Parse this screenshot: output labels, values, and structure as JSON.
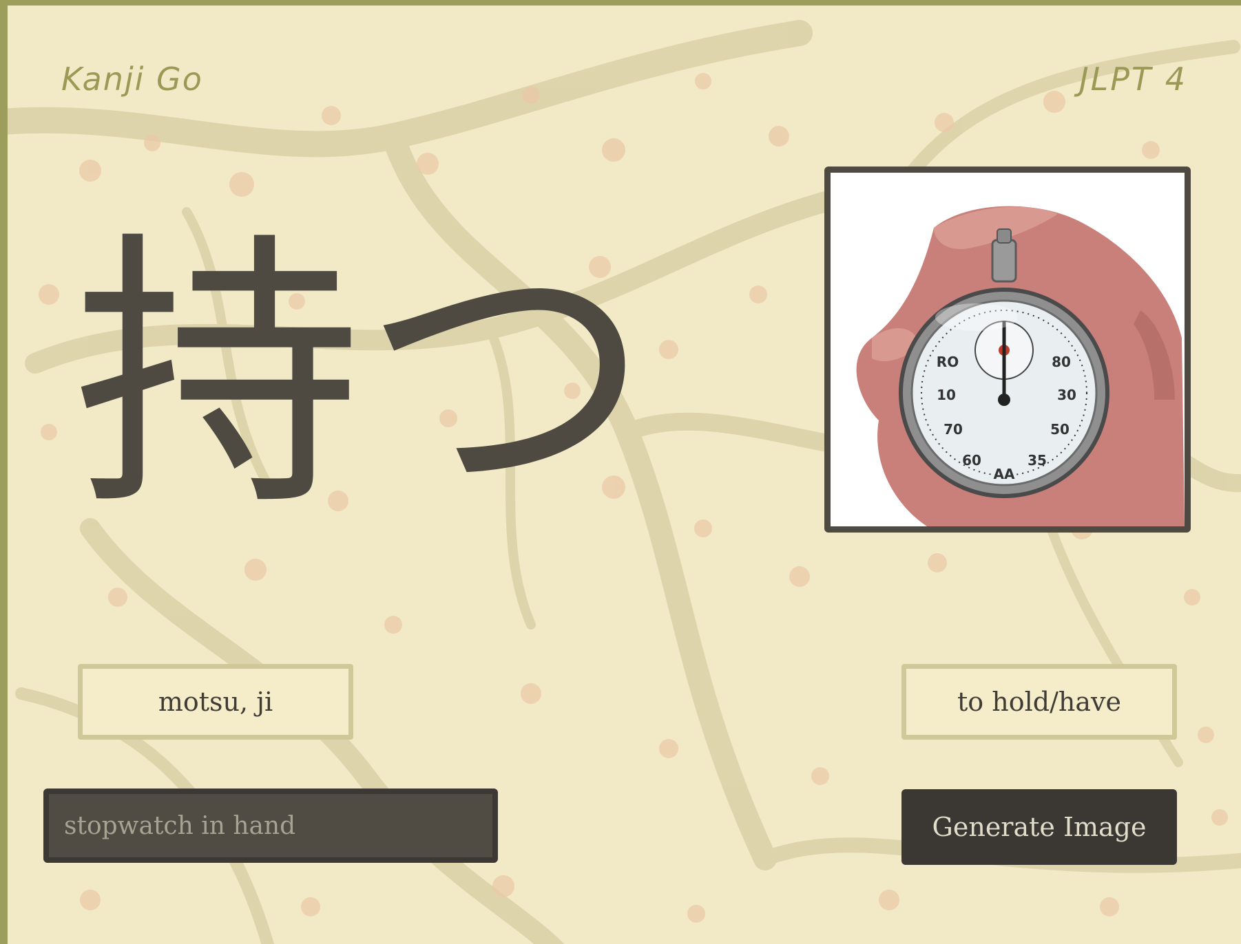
{
  "app": {
    "brand": "Kanji Go",
    "level": "JLPT 4"
  },
  "card": {
    "word": "持つ",
    "reading": "motsu, ji",
    "meaning": "to hold/have",
    "image_alt": "stopwatch in hand"
  },
  "prompt": {
    "value": "",
    "placeholder": "stopwatch in hand"
  },
  "actions": {
    "generate_label": "Generate Image"
  },
  "colors": {
    "background": "#f2e9c6",
    "frame": "#9e9e5c",
    "ink": "#4e4a42",
    "button": "#3b3834",
    "box_border": "#cfc99a"
  },
  "icons": {
    "image": "stopwatch-in-hand-illustration"
  }
}
